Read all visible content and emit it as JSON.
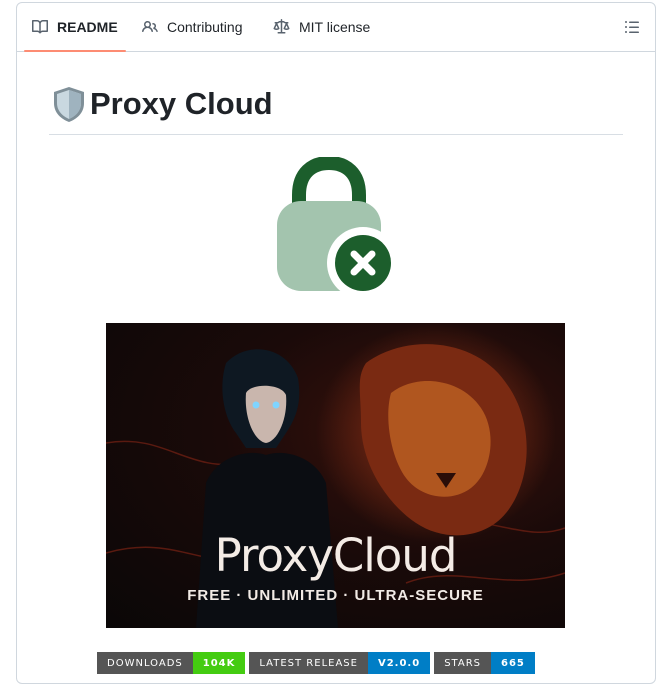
{
  "tabs": [
    {
      "label": "README",
      "icon": "book-icon",
      "active": true
    },
    {
      "label": "Contributing",
      "icon": "people-icon",
      "active": false
    },
    {
      "label": "MIT license",
      "icon": "law-scale-icon",
      "active": false
    }
  ],
  "outline_icon": "list-unordered-icon",
  "readme": {
    "title_emoji": "shield-icon",
    "title": "Proxy Cloud",
    "lock_icon": "lock-error-icon",
    "banner": {
      "title": "ProxyCloud",
      "subtitle": "FREE · UNLIMITED · ULTRA-SECURE"
    },
    "badges": [
      {
        "label": "DOWNLOADS",
        "value": "104K",
        "color": "#4c1"
      },
      {
        "label": "LATEST RELEASE",
        "value": "V2.0.0",
        "color": "#007ec6"
      },
      {
        "label": "STARS",
        "value": "665",
        "color": "#007ec6"
      }
    ]
  },
  "colors": {
    "accent_underline": "#fd8c73",
    "lock_dark": "#1c5e2c",
    "lock_light": "#a3c4ae"
  }
}
